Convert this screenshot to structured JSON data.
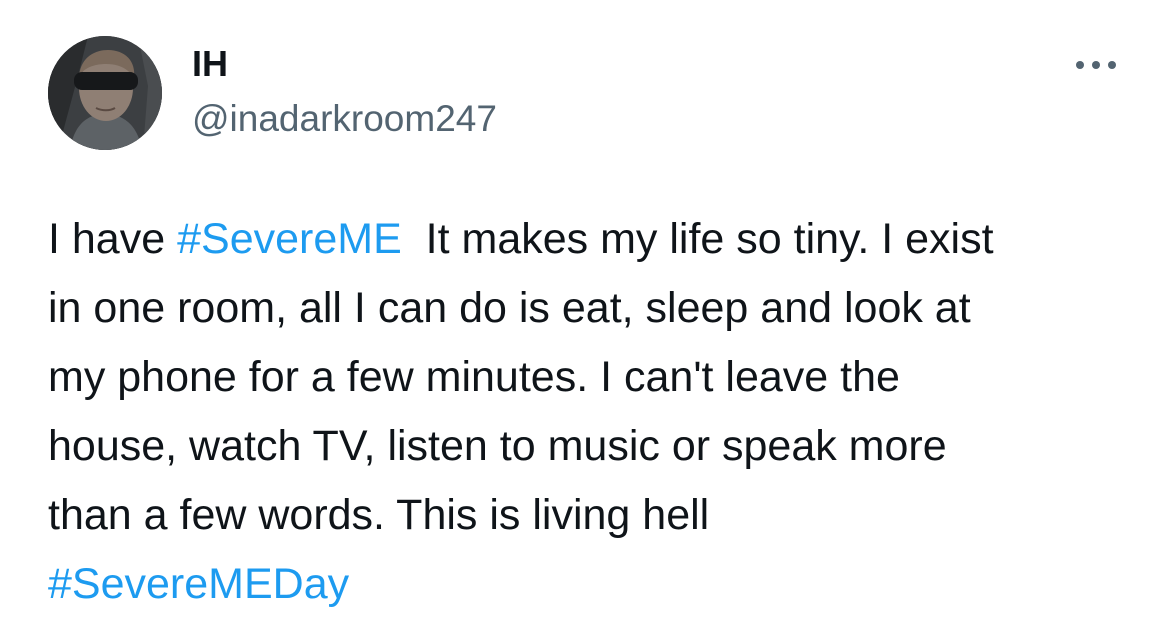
{
  "author": {
    "display_name": "IH",
    "handle": "@inadarkroom247",
    "avatar_icon": "profile-photo-sleep-mask"
  },
  "menu": {
    "more_icon": "more-horizontal-icon"
  },
  "tweet": {
    "line1_pre": "I have ",
    "hashtag1": "#SevereME",
    "line1_post": "  It makes my life so tiny. I exist",
    "line2": "in one room, all I can do is eat, sleep and look at",
    "line3": "my phone for a few minutes. I can't leave the",
    "line4": "house, watch TV, listen to music or speak more",
    "line5": "than a few words. This is living hell",
    "hashtag2": "#SevereMEDay"
  },
  "colors": {
    "text": "#0f1419",
    "secondary": "#536471",
    "link": "#1d9bf0",
    "background": "#ffffff"
  }
}
